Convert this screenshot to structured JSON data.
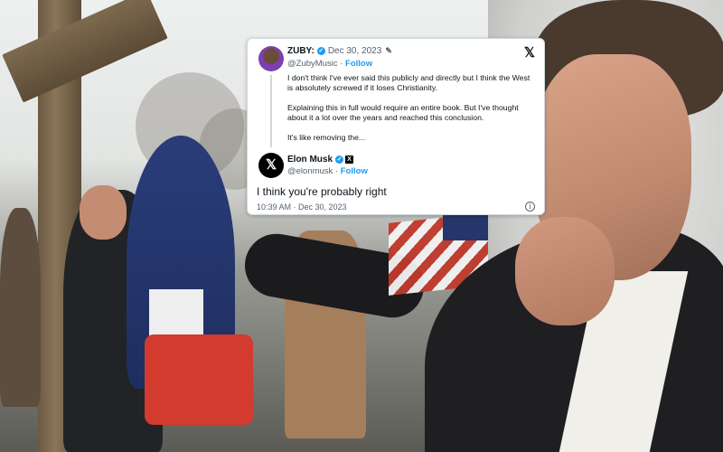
{
  "tweet": {
    "original": {
      "name": "ZUBY:",
      "date": "Dec 30, 2023",
      "handle": "@ZubyMusic",
      "follow_label": "Follow",
      "text_p1": "I don't think I've ever said this publicly and directly but I think the West is absolutely screwed if it loses Christianity.",
      "text_p2": "Explaining this in full would require an entire book. But I've thought about it a lot over the years and reached this conclusion.",
      "text_p3": "It's like removing the..."
    },
    "reply": {
      "name": "Elon Musk",
      "handle": "@elonmusk",
      "follow_label": "Follow",
      "text": "I think you're probably right",
      "timestamp": "10:39 AM · Dec 30, 2023"
    },
    "icons": [
      "x-logo-icon",
      "verified-badge-icon",
      "edit-pencil-icon",
      "info-icon"
    ],
    "accent_color": "#1d9bf0"
  }
}
